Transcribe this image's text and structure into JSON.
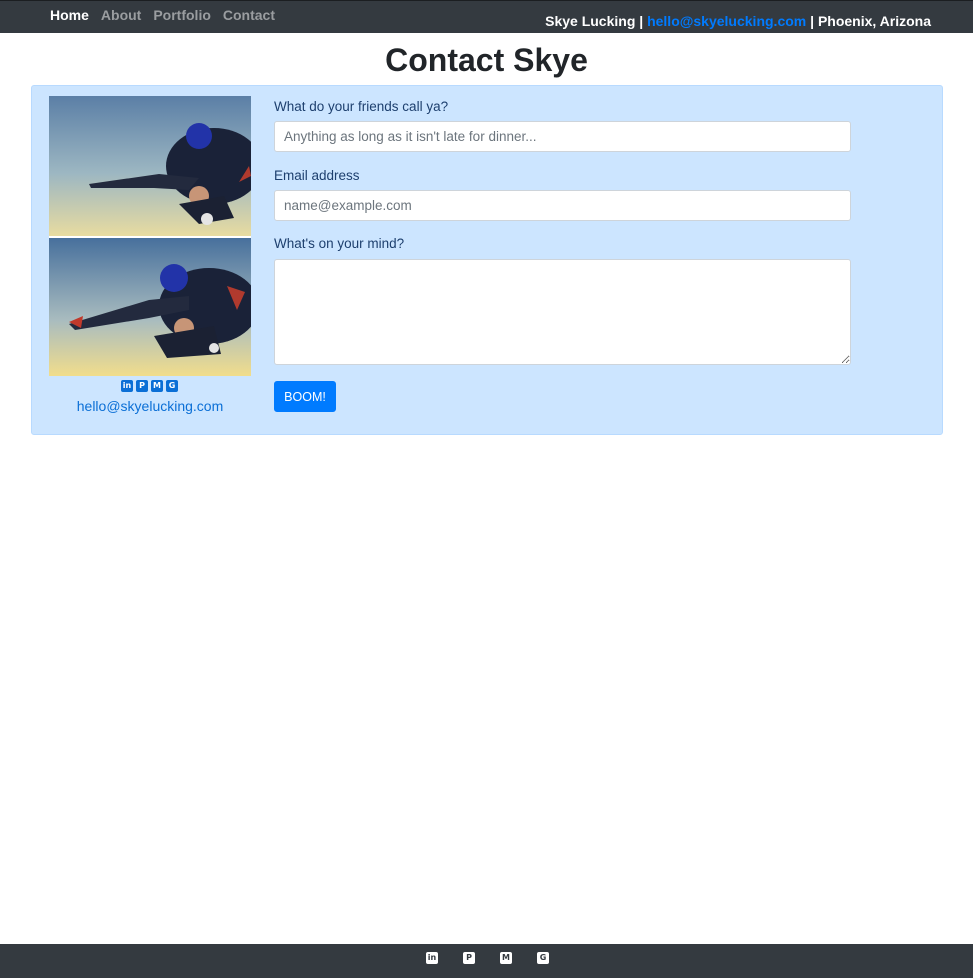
{
  "nav": {
    "links": [
      "Home",
      "About",
      "Portfolio",
      "Contact"
    ],
    "active": "Home",
    "owner": "Skye Lucking",
    "separator": "|",
    "email": "hello@skyelucking.com",
    "location": "Phoenix, Arizona"
  },
  "page": {
    "title": "Contact Skye"
  },
  "card": {
    "photo_icon": "skydiving-photo",
    "social_icons": [
      "linkedin-icon",
      "pinterest-icon",
      "medium-icon",
      "github-icon"
    ],
    "social_glyphs": [
      "in",
      "P",
      "M",
      "G"
    ],
    "email": "hello@skyelucking.com"
  },
  "form": {
    "name_label": "What do your friends call ya?",
    "name_placeholder": "Anything as long as it isn't late for dinner...",
    "email_label": "Email address",
    "email_placeholder": "name@example.com",
    "message_label": "What's on your mind?",
    "submit_label": "BOOM!"
  },
  "footer": {
    "icons": [
      "linkedin-icon",
      "pinterest-icon",
      "medium-icon",
      "github-icon"
    ],
    "glyphs": [
      "in",
      "P",
      "M",
      "G"
    ]
  },
  "colors": {
    "navbar": "#343a40",
    "card_bg": "#cce5ff",
    "accent": "#007bff"
  }
}
